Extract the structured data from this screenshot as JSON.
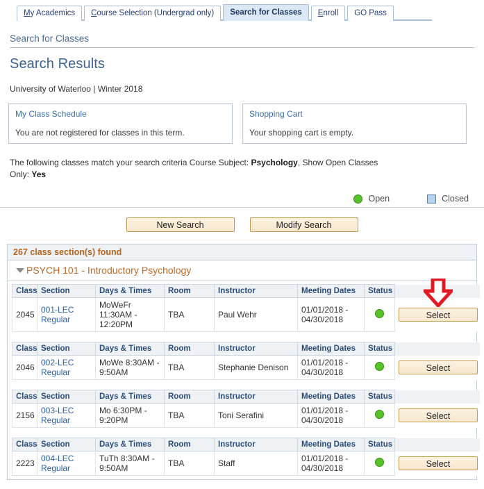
{
  "tabs": [
    {
      "label": "My Academics",
      "accesskey": "M",
      "active": false
    },
    {
      "label": "Course Selection (Undergrad only)",
      "accesskey": "C",
      "active": false
    },
    {
      "label": "Search for Classes",
      "accesskey": "",
      "active": true
    },
    {
      "label": "Enroll",
      "accesskey": "E",
      "active": false
    },
    {
      "label": "GO Pass",
      "accesskey": "",
      "active": false
    }
  ],
  "header": {
    "breadcrumb": "Search for Classes",
    "page_title": "Search Results",
    "institution": "University of Waterloo | Winter 2018"
  },
  "panels": [
    {
      "title": "My Class Schedule",
      "body": "You are not registered for classes in this term."
    },
    {
      "title": "Shopping Cart",
      "body": "Your shopping cart is empty."
    }
  ],
  "criteria": {
    "prefix": "The following classes match your search criteria Course Subject:",
    "subject": "Psychology",
    "middle": ",  Show Open Classes Only:",
    "open_only": "Yes"
  },
  "legend": {
    "open_label": "Open",
    "closed_label": "Closed",
    "open_color": "#58c22b",
    "closed_color": "#b7d2ea"
  },
  "buttons": {
    "new_search": "New Search",
    "modify_search": "Modify Search"
  },
  "results": {
    "found_text": "267 class section(s) found",
    "course_title": "PSYCH 101 - Introductory Psychology",
    "columns": [
      "Class",
      "Section",
      "Days & Times",
      "Room",
      "Instructor",
      "Meeting Dates",
      "Status"
    ],
    "select_label": "Select",
    "rows": [
      {
        "class": "2045",
        "section_code": "001-LEC",
        "section_type": "Regular",
        "days_times": "MoWeFr 11:30AM - 12:20PM",
        "room": "TBA",
        "instructor": "Paul Wehr",
        "meeting_dates": "01/01/2018 - 04/30/2018",
        "status": "open"
      },
      {
        "class": "2046",
        "section_code": "002-LEC",
        "section_type": "Regular",
        "days_times": "MoWe 8:30AM - 9:50AM",
        "room": "TBA",
        "instructor": "Stephanie Denison",
        "meeting_dates": "01/01/2018 - 04/30/2018",
        "status": "open"
      },
      {
        "class": "2156",
        "section_code": "003-LEC",
        "section_type": "Regular",
        "days_times": "Mo 6:30PM - 9:20PM",
        "room": "TBA",
        "instructor": "Toni Serafini",
        "meeting_dates": "01/01/2018 - 04/30/2018",
        "status": "open"
      },
      {
        "class": "2223",
        "section_code": "004-LEC",
        "section_type": "Regular",
        "days_times": "TuTh 8:30AM - 9:50AM",
        "room": "TBA",
        "instructor": "Staff",
        "meeting_dates": "01/01/2018 - 04/30/2018",
        "status": "open"
      }
    ]
  },
  "annotation": {
    "arrow_color": "#e01b24",
    "target": "select-button-row-1"
  }
}
